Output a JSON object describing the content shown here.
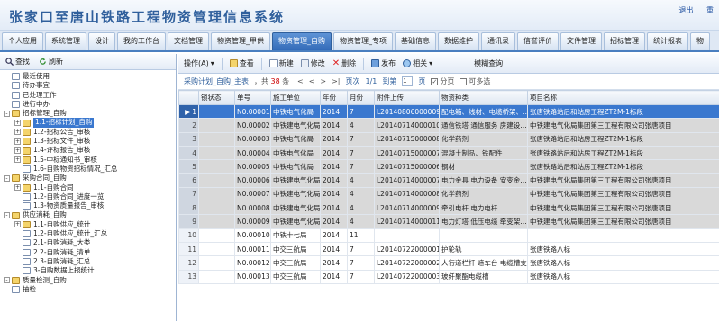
{
  "header": {
    "title": "张家口至唐山铁路工程物资管理信息系统",
    "logout": "退出",
    "help": "重"
  },
  "nav": {
    "tabs": [
      "个人应用",
      "系统管理",
      "设计",
      "我的工作台",
      "文档管理",
      "物资管理_甲供",
      "物资管理_自购",
      "物资管理_专项",
      "基础信息",
      "数据维护",
      "通讯录",
      "信誉评价",
      "文件管理",
      "招标管理",
      "统计报表",
      "物"
    ],
    "active_index": 6
  },
  "left": {
    "toolbar": {
      "search": "查找",
      "refresh": "刷新"
    },
    "tree": [
      {
        "label": "最近使用",
        "exp": "",
        "type": "doc"
      },
      {
        "label": "待办事宜",
        "exp": "",
        "type": "doc"
      },
      {
        "label": "已处理工作",
        "exp": "",
        "type": "doc"
      },
      {
        "label": "进行中办",
        "exp": "",
        "type": "doc"
      },
      {
        "label": "招标管理_自购",
        "exp": "-",
        "type": "folder"
      },
      {
        "label": "1.1-招标计划_自购",
        "exp": "+",
        "type": "folder",
        "selected": true
      },
      {
        "label": "1.2-招标公告_审核",
        "exp": "+",
        "type": "folder"
      },
      {
        "label": "1.3-招标文件_审核",
        "exp": "+",
        "type": "folder"
      },
      {
        "label": "1.4-评标报告_审核",
        "exp": "+",
        "type": "folder"
      },
      {
        "label": "1.5-中标通知书_审核",
        "exp": "+",
        "type": "folder"
      },
      {
        "label": "1.6-自购物资招标情况_汇总",
        "exp": "",
        "type": "doc"
      },
      {
        "label": "采购合同_自购",
        "exp": "-",
        "type": "folder"
      },
      {
        "label": "1.1-自购合同",
        "exp": "+",
        "type": "folder"
      },
      {
        "label": "1.2-自购合同_进度一览",
        "exp": "",
        "type": "doc"
      },
      {
        "label": "1.3-物资质量报告_审核",
        "exp": "",
        "type": "doc"
      },
      {
        "label": "供应消耗_自购",
        "exp": "-",
        "type": "folder"
      },
      {
        "label": "1.1-自购供应_统计",
        "exp": "+",
        "type": "folder"
      },
      {
        "label": "1.2-自购供应_统计_汇总",
        "exp": "",
        "type": "doc"
      },
      {
        "label": "2.1-自购消耗_大类",
        "exp": "",
        "type": "doc"
      },
      {
        "label": "2.2-自购消耗_清单",
        "exp": "",
        "type": "doc"
      },
      {
        "label": "2.3-自购消耗_汇总",
        "exp": "",
        "type": "doc"
      },
      {
        "label": "3-自购数据上报统计",
        "exp": "",
        "type": "doc"
      },
      {
        "label": "质量检测_自购",
        "exp": "-",
        "type": "folder"
      },
      {
        "label": "抽检",
        "exp": "",
        "type": "doc"
      }
    ]
  },
  "main": {
    "toolbar": {
      "operate": "操作(A)",
      "view": "查看",
      "new": "新建",
      "edit": "修改",
      "delete": "删除",
      "publish": "发布",
      "related": "相关",
      "fuzzy": "模糊查询"
    },
    "pager": {
      "crumb": "采购计划_自购_主表",
      "total_prefix": "，共",
      "total": "38",
      "total_suffix": "条",
      "page_label": "页次",
      "page": "1/1",
      "goto_prefix": "到第",
      "goto_value": "1",
      "goto_suffix": "页",
      "paging": "分页",
      "multi": "可多选"
    },
    "columns": [
      "",
      "锁状态",
      "单号",
      "施工单位",
      "年份",
      "月份",
      "附件上传",
      "物资种类",
      "项目名称"
    ],
    "rows": [
      [
        "▶ 1",
        "",
        "N0.00001",
        "中铁电气化局",
        "2014",
        "7",
        "L20140806000009",
        "配电箱、线材、电缆桥架、…",
        "张唐铁路站后和站房工程ZT2M-1标段"
      ],
      [
        "2",
        "",
        "N0.00002",
        "中铁建电气化局",
        "2014",
        "4",
        "L20140714000010",
        "通信铁塔 通信服务 房建设…",
        "中铁建电气化局集团第三工程有限公司张唐项目"
      ],
      [
        "3",
        "",
        "N0.00003",
        "中铁电气化局",
        "2014",
        "7",
        "L20140715000008",
        "化学药剂",
        "张唐铁路站后和站房工程ZT2M-1标段"
      ],
      [
        "4",
        "",
        "N0.00004",
        "中铁电气化局",
        "2014",
        "7",
        "L20140715000007",
        "混凝土制品、铁配件",
        "张唐铁路站后和站房工程ZT2M-1标段"
      ],
      [
        "5",
        "",
        "N0.00005",
        "中铁电气化局",
        "2014",
        "7",
        "L20140715000006",
        "钢材",
        "张唐铁路站后和站房工程ZT2M-1标段"
      ],
      [
        "6",
        "",
        "N0.00006",
        "中铁建电气化局",
        "2014",
        "4",
        "L20140714000007",
        "电力金具 电力设备 安变金…",
        "中铁建电气化局集团第三工程有限公司张唐项目"
      ],
      [
        "7",
        "",
        "N0.00007",
        "中铁建电气化局",
        "2014",
        "4",
        "L20140714000008",
        "化学药剂",
        "中铁建电气化局集团第三工程有限公司张唐项目"
      ],
      [
        "8",
        "",
        "N0.00008",
        "中铁建电气化局",
        "2014",
        "4",
        "L20140714000009",
        "牵引电杆 电力电杆",
        "中铁建电气化局集团第三工程有限公司张唐项目"
      ],
      [
        "9",
        "",
        "N0.00009",
        "中铁建电气化局",
        "2014",
        "4",
        "L20140714000011",
        "电力灯塔 低压电缆 牵变架…",
        "中铁建电气化局集团第三工程有限公司张唐项目"
      ],
      [
        "10",
        "",
        "N0.00010",
        "中铁十七局",
        "2014",
        "11",
        "",
        "",
        ""
      ],
      [
        "11",
        "",
        "N0.00011",
        "中交三航局",
        "2014",
        "7",
        "L20140722000001",
        "护轮轨",
        "张唐铁路八标"
      ],
      [
        "12",
        "",
        "N0.00012",
        "中交三航局",
        "2014",
        "7",
        "L20140722000002",
        "人行道栏杆 遮车台 电缆槽支架",
        "张唐铁路八标"
      ],
      [
        "13",
        "",
        "N0.00013",
        "中交三航局",
        "2014",
        "7",
        "L20140722000003",
        "玻纤聚酯电缆槽",
        "张唐铁路八标"
      ]
    ],
    "gray_rows": [
      1,
      2,
      3,
      4,
      5,
      6,
      7,
      8
    ]
  },
  "colors": {
    "accent": "#3a78cf",
    "title": "#2f5f9c"
  }
}
